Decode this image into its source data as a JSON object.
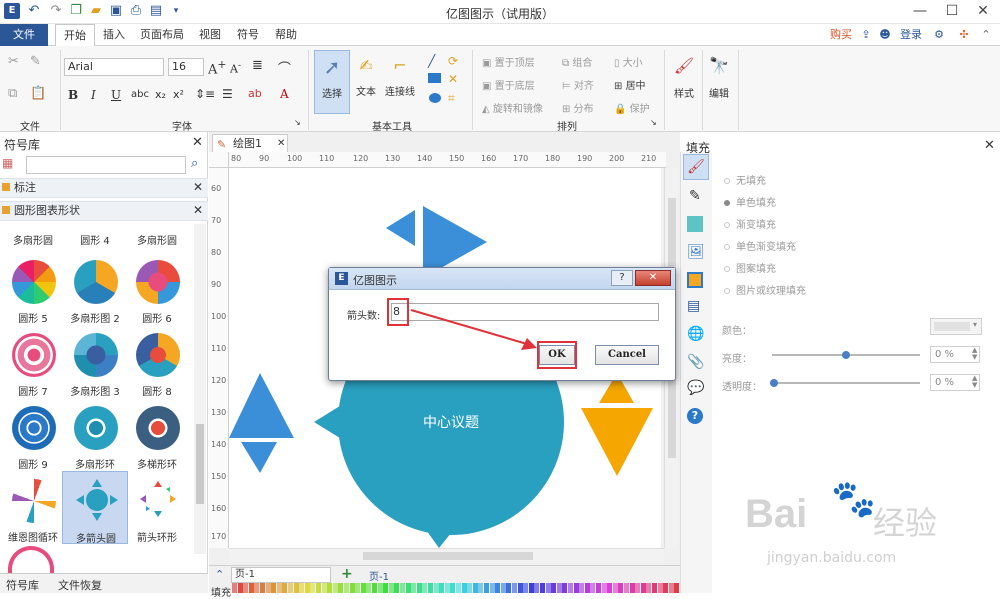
{
  "app": {
    "title": "亿图图示（试用版）"
  },
  "quick_access": [
    "logo-icon",
    "undo-icon",
    "redo-icon",
    "new-icon",
    "open-icon",
    "save-icon",
    "print-icon",
    "export-icon",
    "more-icon"
  ],
  "window_controls": {
    "minimize": "—",
    "maximize": "☐",
    "close": "✕"
  },
  "menu": {
    "file": "文件",
    "tabs": [
      "开始",
      "插入",
      "页面布局",
      "视图",
      "符号",
      "帮助"
    ],
    "right": {
      "buy": "购买",
      "login": "登录"
    }
  },
  "ribbon": {
    "font_name": "Arial",
    "font_size": "16",
    "groups": {
      "file": "文件",
      "font": "字体",
      "basic_tools": "基本工具",
      "arrange": "排列"
    },
    "tools": {
      "select": "选择",
      "text": "文本",
      "connector": "连接线",
      "style": "样式",
      "edit": "编辑"
    },
    "arrange_items": [
      "置于顶层",
      "组合",
      "大小",
      "置于底层",
      "对齐",
      "居中",
      "旋转和镜像",
      "分布",
      "保护"
    ]
  },
  "library": {
    "title": "符号库",
    "categories": [
      "标注",
      "圆形图表形状"
    ],
    "shapes": [
      {
        "label": "多扇形圆"
      },
      {
        "label": "圆形 4"
      },
      {
        "label": "多扇形圆"
      },
      {
        "label": "圆形 5"
      },
      {
        "label": "多扇形图 2"
      },
      {
        "label": "圆形 6"
      },
      {
        "label": "圆形 7"
      },
      {
        "label": "多扇形图 3"
      },
      {
        "label": "圆形 8"
      },
      {
        "label": "圆形 9"
      },
      {
        "label": "多扇形环"
      },
      {
        "label": "多梯形环"
      },
      {
        "label": "维恩图循环"
      },
      {
        "label": "多箭头圆"
      },
      {
        "label": "箭头环形"
      }
    ],
    "bottom_tabs": [
      "符号库",
      "文件恢复"
    ]
  },
  "document": {
    "tab": "绘图1",
    "ruler_top": [
      "80",
      "90",
      "100",
      "110",
      "120",
      "130",
      "140",
      "150",
      "160",
      "170",
      "180",
      "190",
      "200",
      "210"
    ],
    "ruler_left": [
      "60",
      "70",
      "80",
      "90",
      "100",
      "110",
      "120",
      "130",
      "140",
      "150",
      "160",
      "170"
    ],
    "center_text": "中心议题",
    "page_selector": "页-1",
    "page_tab": "页-1",
    "fill_label": "填充"
  },
  "dialog": {
    "title": "亿图图示",
    "help": "?",
    "close": "✕",
    "label": "箭头数:",
    "value": "8",
    "ok": "OK",
    "cancel": "Cancel"
  },
  "fill_panel": {
    "title": "填充",
    "options": [
      "无填充",
      "单色填充",
      "渐变填充",
      "单色渐变填充",
      "图案填充",
      "图片或纹理填充"
    ],
    "color_label": "颜色：",
    "brightness_label": "亮度：",
    "brightness_value": "0 %",
    "transparency_label": "透明度：",
    "transparency_value": "0 %"
  },
  "watermark": {
    "brand": "Bai",
    "brand2": "经验",
    "url": "jingyan.baidu.com"
  },
  "colors": {
    "accent": "#2b579a",
    "teal": "#2aa0c0",
    "arrow_orange": "#f5a600",
    "arrow_blue": "#3a8fd8",
    "highlight": "#e0323a"
  }
}
